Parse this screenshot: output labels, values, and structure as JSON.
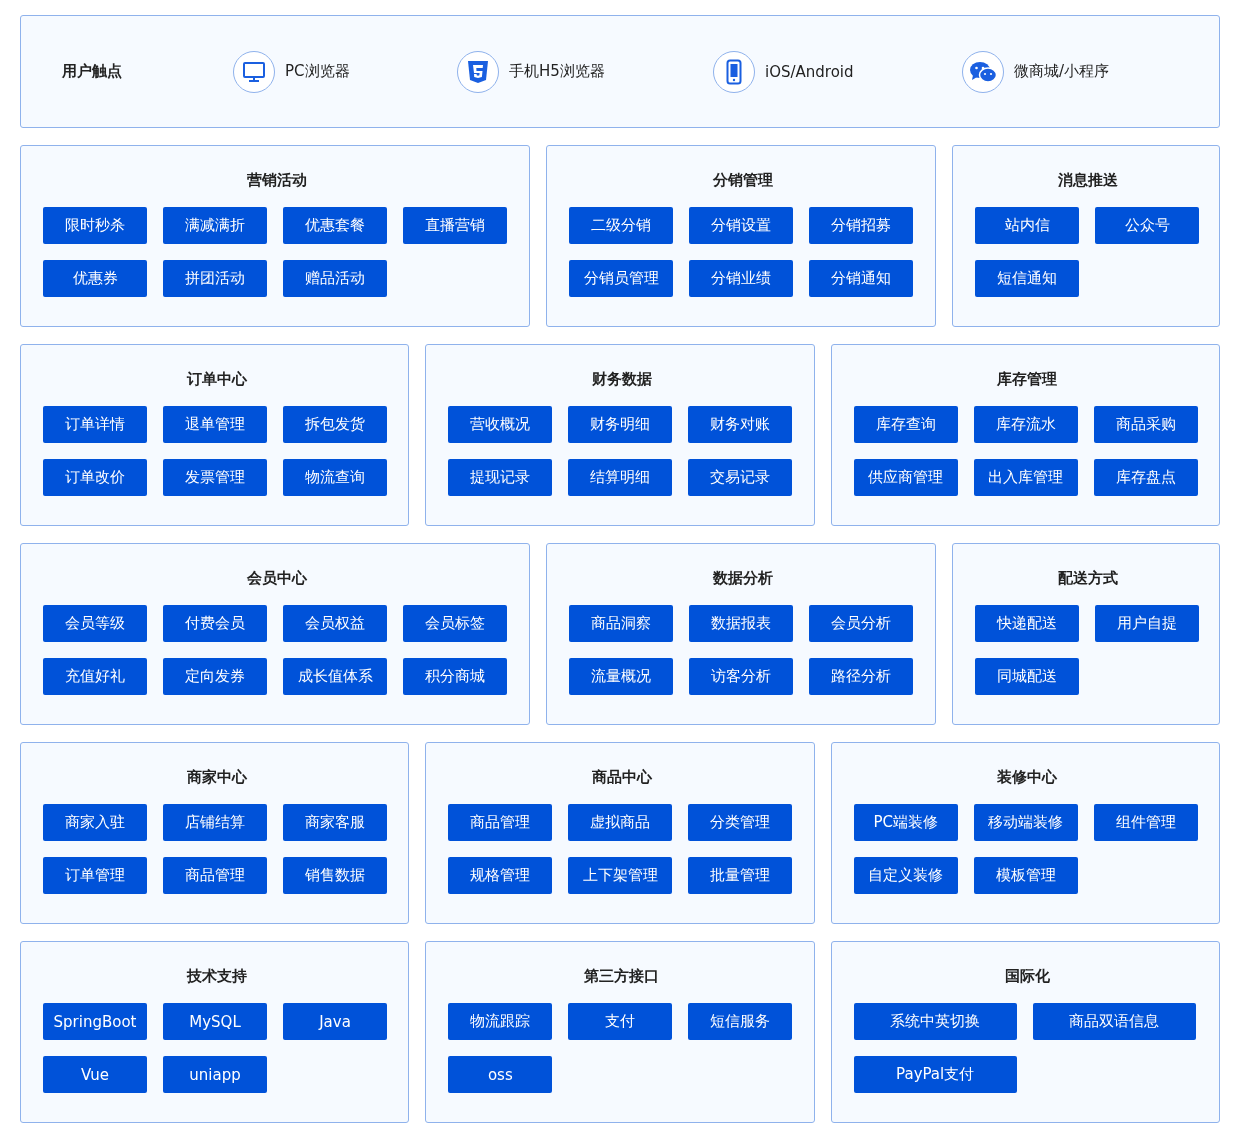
{
  "touchpoints": {
    "label": "用户触点",
    "items": [
      {
        "kind": "monitor",
        "label": "PC浏览器"
      },
      {
        "kind": "html5",
        "label": "手机H5浏览器"
      },
      {
        "kind": "phone",
        "label": "iOS/Android"
      },
      {
        "kind": "chat",
        "label": "微商城/小程序"
      }
    ]
  },
  "rows": [
    {
      "panels": [
        {
          "title": "营销活动",
          "kind": "standard",
          "buttons": [
            "限时秒杀",
            "满减满折",
            "优惠套餐",
            "直播营销",
            "优惠券",
            "拼团活动",
            "赠品活动"
          ]
        },
        {
          "title": "分销管理",
          "kind": "standard",
          "buttons": [
            "二级分销",
            "分销设置",
            "分销招募",
            "分销员管理",
            "分销业绩",
            "分销通知"
          ]
        },
        {
          "title": "消息推送",
          "kind": "standard",
          "buttons": [
            "站内信",
            "公众号",
            "短信通知"
          ]
        }
      ]
    },
    {
      "panels": [
        {
          "title": "订单中心",
          "kind": "standard",
          "buttons": [
            "订单详情",
            "退单管理",
            "拆包发货",
            "订单改价",
            "发票管理",
            "物流查询"
          ]
        },
        {
          "title": "财务数据",
          "kind": "standard",
          "buttons": [
            "营收概况",
            "财务明细",
            "财务对账",
            "提现记录",
            "结算明细",
            "交易记录"
          ]
        },
        {
          "title": "库存管理",
          "kind": "standard",
          "buttons": [
            "库存查询",
            "库存流水",
            "商品采购",
            "供应商管理",
            "出入库管理",
            "库存盘点"
          ]
        }
      ]
    },
    {
      "panels": [
        {
          "title": "会员中心",
          "kind": "standard",
          "buttons": [
            "会员等级",
            "付费会员",
            "会员权益",
            "会员标签",
            "充值好礼",
            "定向发券",
            "成长值体系",
            "积分商城"
          ]
        },
        {
          "title": "数据分析",
          "kind": "standard",
          "buttons": [
            "商品洞察",
            "数据报表",
            "会员分析",
            "流量概况",
            "访客分析",
            "路径分析"
          ]
        },
        {
          "title": "配送方式",
          "kind": "standard",
          "buttons": [
            "快递配送",
            "用户自提",
            "同城配送"
          ]
        }
      ]
    },
    {
      "panels": [
        {
          "title": "商家中心",
          "kind": "standard",
          "buttons": [
            "商家入驻",
            "店铺结算",
            "商家客服",
            "订单管理",
            "商品管理",
            "销售数据"
          ]
        },
        {
          "title": "商品中心",
          "kind": "standard",
          "buttons": [
            "商品管理",
            "虚拟商品",
            "分类管理",
            "规格管理",
            "上下架管理",
            "批量管理"
          ]
        },
        {
          "title": "装修中心",
          "kind": "standard",
          "buttons": [
            "PC端装修",
            "移动端装修",
            "组件管理",
            "自定义装修",
            "模板管理"
          ]
        }
      ]
    },
    {
      "panels": [
        {
          "title": "技术支持",
          "kind": "standard",
          "buttons": [
            "SpringBoot",
            "MySQL",
            "Java",
            "Vue",
            "uniapp"
          ]
        },
        {
          "title": "第三方接口",
          "kind": "standard",
          "buttons": [
            "物流跟踪",
            "支付",
            "短信服务",
            "oss"
          ]
        },
        {
          "title": "国际化",
          "kind": "wide",
          "buttons": [
            "系统中英切换",
            "商品双语信息",
            "PayPal支付"
          ]
        }
      ]
    }
  ]
}
